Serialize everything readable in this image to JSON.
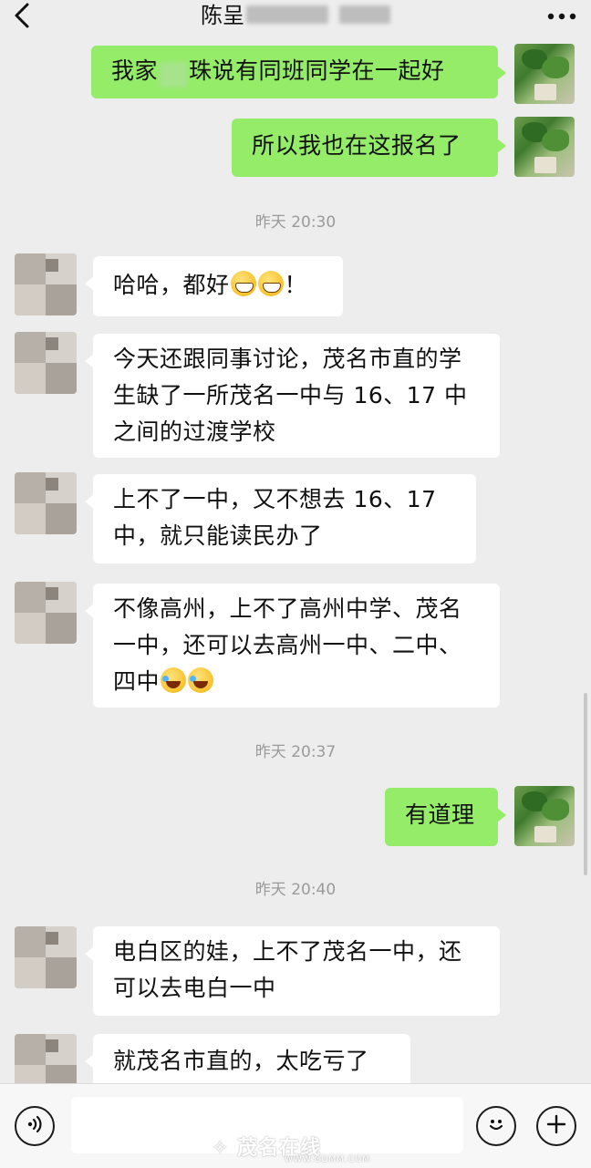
{
  "header": {
    "title": "陈呈",
    "back_icon": "chevron-left-icon",
    "more_icon": "more-dots-icon"
  },
  "messages": [
    {
      "side": "right",
      "parts": [
        "我家",
        "珠说有同班同学在一起好"
      ]
    },
    {
      "side": "right",
      "text": "所以我也在这报名了"
    },
    {
      "side": "left",
      "text": "哈哈，都好",
      "suffix": "！"
    },
    {
      "side": "left",
      "lines": [
        "今天还跟同事讨论，茂名市直的学",
        "生缺了一所茂名一中与 16、17 中",
        "之间的过渡学校"
      ]
    },
    {
      "side": "left",
      "lines": [
        "上不了一中，又不想去 16、17",
        "中，就只能读民办了"
      ]
    },
    {
      "side": "left",
      "lines": [
        "不像高州，上不了高州中学、茂名",
        "一中，还可以去高州一中、二中、",
        "四中"
      ]
    },
    {
      "side": "right",
      "text": "有道理"
    },
    {
      "side": "left",
      "lines": [
        "电白区的娃，上不了茂名一中，还",
        "可以去电白一中"
      ]
    },
    {
      "side": "left",
      "text": "就茂名市直的，太吃亏了"
    }
  ],
  "timestamps": [
    "昨天 20:30",
    "昨天 20:37",
    "昨天 20:40"
  ],
  "bottom": {
    "voice_icon": "voice-icon",
    "emoji_icon": "smiley-icon",
    "plus_icon": "plus-icon",
    "watermark": "茂名在线",
    "watermark_url": "WWW.GDMM.COM"
  }
}
